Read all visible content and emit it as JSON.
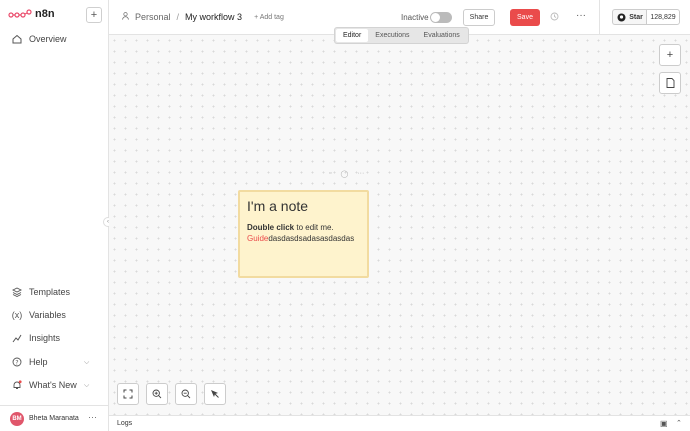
{
  "app": {
    "name": "n8n"
  },
  "sidebar": {
    "add_label": "+",
    "items": [
      {
        "label": "Overview",
        "icon": "home-icon"
      },
      {
        "label": "Templates",
        "icon": "templates-icon"
      },
      {
        "label": "Variables",
        "icon": "variables-icon"
      },
      {
        "label": "Insights",
        "icon": "insights-icon"
      },
      {
        "label": "Help",
        "icon": "help-icon"
      },
      {
        "label": "What's New",
        "icon": "bell-icon"
      }
    ],
    "user": {
      "initials": "BM",
      "name": "Bheta Maranata"
    }
  },
  "header": {
    "project": "Personal",
    "separator": "/",
    "workflow_name": "My workflow 3",
    "add_tag": "+ Add tag",
    "status_label": "Inactive",
    "share_label": "Share",
    "save_label": "Save",
    "star_label": "Star",
    "star_count": "128,829"
  },
  "tabs": [
    {
      "label": "Editor",
      "active": true
    },
    {
      "label": "Executions",
      "active": false
    },
    {
      "label": "Evaluations",
      "active": false
    }
  ],
  "note": {
    "title": "I'm a note",
    "body_bold": "Double click",
    "body_rest": " to edit me.",
    "link": "Guide",
    "link_rest": "dasdasdsadasasdasdas"
  },
  "logs": {
    "label": "Logs"
  },
  "colors": {
    "accent": "#ea4b4b",
    "note_bg": "#fef3cd"
  }
}
